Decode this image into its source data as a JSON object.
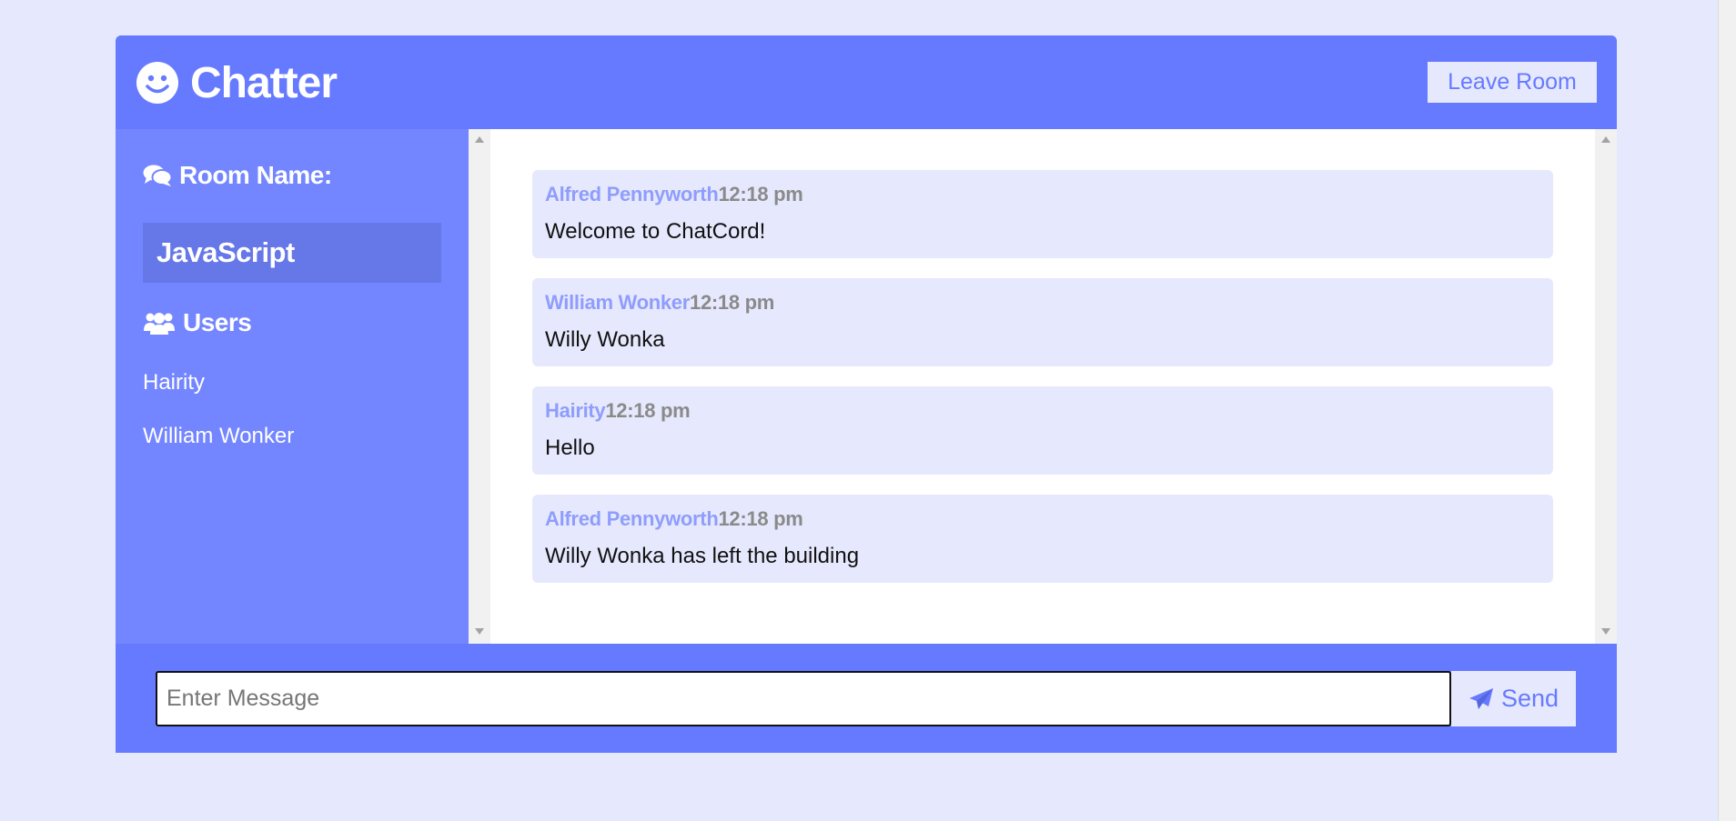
{
  "header": {
    "app_title": "Chatter",
    "logo_icon": "smile-icon",
    "leave_label": "Leave Room"
  },
  "sidebar": {
    "room_heading": "Room Name:",
    "room_icon": "comments-icon",
    "room_name": "JavaScript",
    "users_heading": "Users",
    "users_icon": "users-icon",
    "users": [
      "Hairity",
      "William Wonker"
    ]
  },
  "messages": [
    {
      "author": "Alfred Pennyworth",
      "time": "12:18 pm",
      "text": "Welcome to ChatCord!"
    },
    {
      "author": "William Wonker",
      "time": "12:18 pm",
      "text": "Willy Wonka"
    },
    {
      "author": "Hairity",
      "time": "12:18 pm",
      "text": "Hello"
    },
    {
      "author": "Alfred Pennyworth",
      "time": "12:18 pm",
      "text": "Willy Wonka has left the building"
    }
  ],
  "form": {
    "placeholder": "Enter Message",
    "send_label": "Send",
    "send_icon": "paper-plane-icon"
  },
  "colors": {
    "primary": "#667aff",
    "secondary": "#7386ff",
    "light": "#e6e9fd",
    "room_highlight": "#6677e8"
  }
}
